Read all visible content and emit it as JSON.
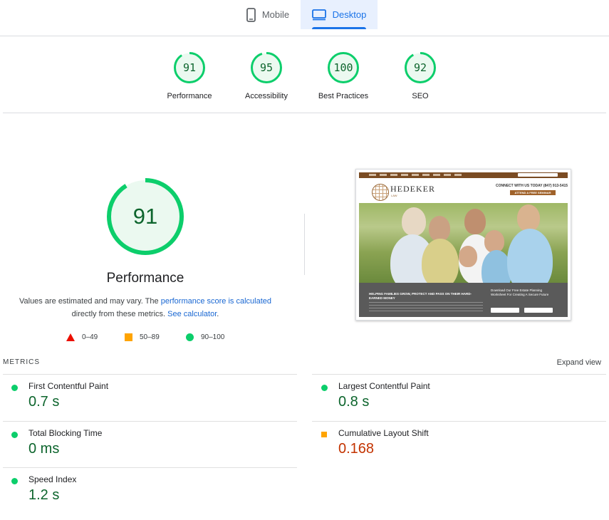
{
  "tabs": [
    {
      "label": "Mobile",
      "icon": "smartphone-icon",
      "selected": false
    },
    {
      "label": "Desktop",
      "icon": "monitor-icon",
      "selected": true
    }
  ],
  "colors": {
    "pass": "#0cce6b",
    "average": "#ffa400",
    "fail": "#ff4e42",
    "accent": "#1a73e8"
  },
  "gauges": [
    {
      "score": 91,
      "label": "Performance"
    },
    {
      "score": 95,
      "label": "Accessibility"
    },
    {
      "score": 100,
      "label": "Best Practices"
    },
    {
      "score": 92,
      "label": "SEO"
    }
  ],
  "performance": {
    "score": 91,
    "title": "Performance",
    "desc_prefix": "Values are estimated and may vary. The ",
    "desc_link1": "performance score is calculated",
    "desc_middle": " directly from these metrics. ",
    "desc_link2": "See calculator",
    "desc_suffix": "."
  },
  "legend": [
    {
      "range": "0–49",
      "shape": "triangle"
    },
    {
      "range": "50–89",
      "shape": "square"
    },
    {
      "range": "90–100",
      "shape": "circle"
    }
  ],
  "screenshot": {
    "logo": "HEDEKER",
    "logo_sub": "LAW",
    "phone": "CONNECT WITH US TODAY (847) 913-5415",
    "cta": "ATTEND A FREE SEMINAR",
    "headline": "HELPING FAMILIES GROW, PROTECT AND PASS ON THEIR HARD-EARNED MONEY",
    "form_title": "Download Our Free Estate Planning Worksheet For Creating A Secure Future"
  },
  "metrics": {
    "header": "METRICS",
    "expand_label": "Expand view",
    "items": [
      {
        "name": "First Contentful Paint",
        "value": "0.7 s",
        "rating": "good"
      },
      {
        "name": "Largest Contentful Paint",
        "value": "0.8 s",
        "rating": "good"
      },
      {
        "name": "Total Blocking Time",
        "value": "0 ms",
        "rating": "good"
      },
      {
        "name": "Cumulative Layout Shift",
        "value": "0.168",
        "rating": "average"
      },
      {
        "name": "Speed Index",
        "value": "1.2 s",
        "rating": "good"
      }
    ]
  }
}
